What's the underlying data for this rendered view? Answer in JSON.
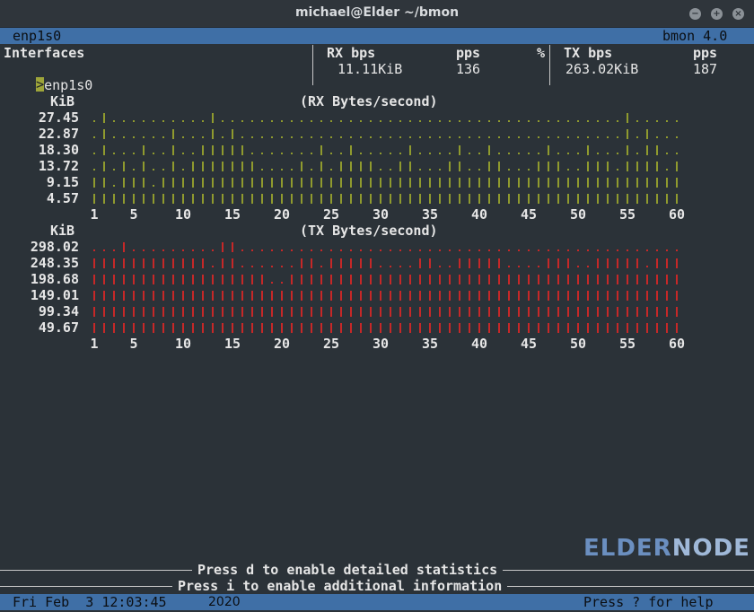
{
  "window": {
    "title": "michael@Elder ~/bmon"
  },
  "header": {
    "left": "enp1s0",
    "right": "bmon 4.0"
  },
  "table": {
    "interfaces_label": "Interfaces",
    "rx_bps_label": "RX bps",
    "rx_pps_label": "pps",
    "percent_label": "%",
    "tx_bps_label": "TX bps",
    "tx_pps_label": "pps",
    "row": {
      "cursor": ">",
      "name": "enp1s0",
      "rx_bps": "11.11KiB",
      "rx_pps": "136",
      "tx_bps": "263.02KiB",
      "tx_pps": "187"
    }
  },
  "colors": {
    "rx": "#8f9a2e",
    "tx": "#c62828",
    "bar": "#3f6fa6"
  },
  "rx_graph": {
    "unit": "KiB",
    "title": "(RX Bytes/second)",
    "levels": [
      "27.45",
      "22.87",
      "18.30",
      "13.72",
      "9.15",
      "4.57"
    ],
    "heights": [
      2,
      6,
      1,
      3,
      2,
      4,
      1,
      2,
      5,
      2,
      3,
      4,
      6,
      4,
      5,
      4,
      3,
      2,
      2,
      2,
      2,
      3,
      2,
      4,
      2,
      3,
      4,
      3,
      3,
      2,
      2,
      3,
      4,
      2,
      2,
      2,
      3,
      4,
      2,
      2,
      4,
      3,
      2,
      2,
      2,
      3,
      4,
      3,
      2,
      2,
      4,
      3,
      3,
      2,
      6,
      3,
      5,
      4,
      2,
      3
    ]
  },
  "tx_graph": {
    "unit": "KiB",
    "title": "(TX Bytes/second)",
    "levels": [
      "298.02",
      "248.35",
      "198.68",
      "149.01",
      "99.34",
      "49.67"
    ],
    "heights": [
      5,
      5,
      5,
      6,
      5,
      5,
      5,
      5,
      5,
      5,
      5,
      5,
      4,
      6,
      6,
      4,
      4,
      4,
      3,
      3,
      4,
      5,
      5,
      4,
      5,
      5,
      5,
      5,
      5,
      4,
      4,
      4,
      4,
      5,
      5,
      4,
      4,
      5,
      5,
      5,
      5,
      5,
      4,
      4,
      4,
      4,
      5,
      5,
      5,
      4,
      4,
      5,
      5,
      5,
      5,
      5,
      4,
      5,
      5,
      5
    ]
  },
  "x_ticks": [
    "1",
    "5",
    "10",
    "15",
    "20",
    "25",
    "30",
    "35",
    "40",
    "45",
    "50",
    "55",
    "60"
  ],
  "hints": {
    "detailed": "Press d to enable detailed statistics",
    "info": "Press i to enable additional information"
  },
  "status": {
    "datetime": "Fri Feb  3 12:03:45",
    "year": "2020",
    "help": "Press ? for help"
  },
  "logo": {
    "text1": "ELDER",
    "text2": "NODE"
  }
}
